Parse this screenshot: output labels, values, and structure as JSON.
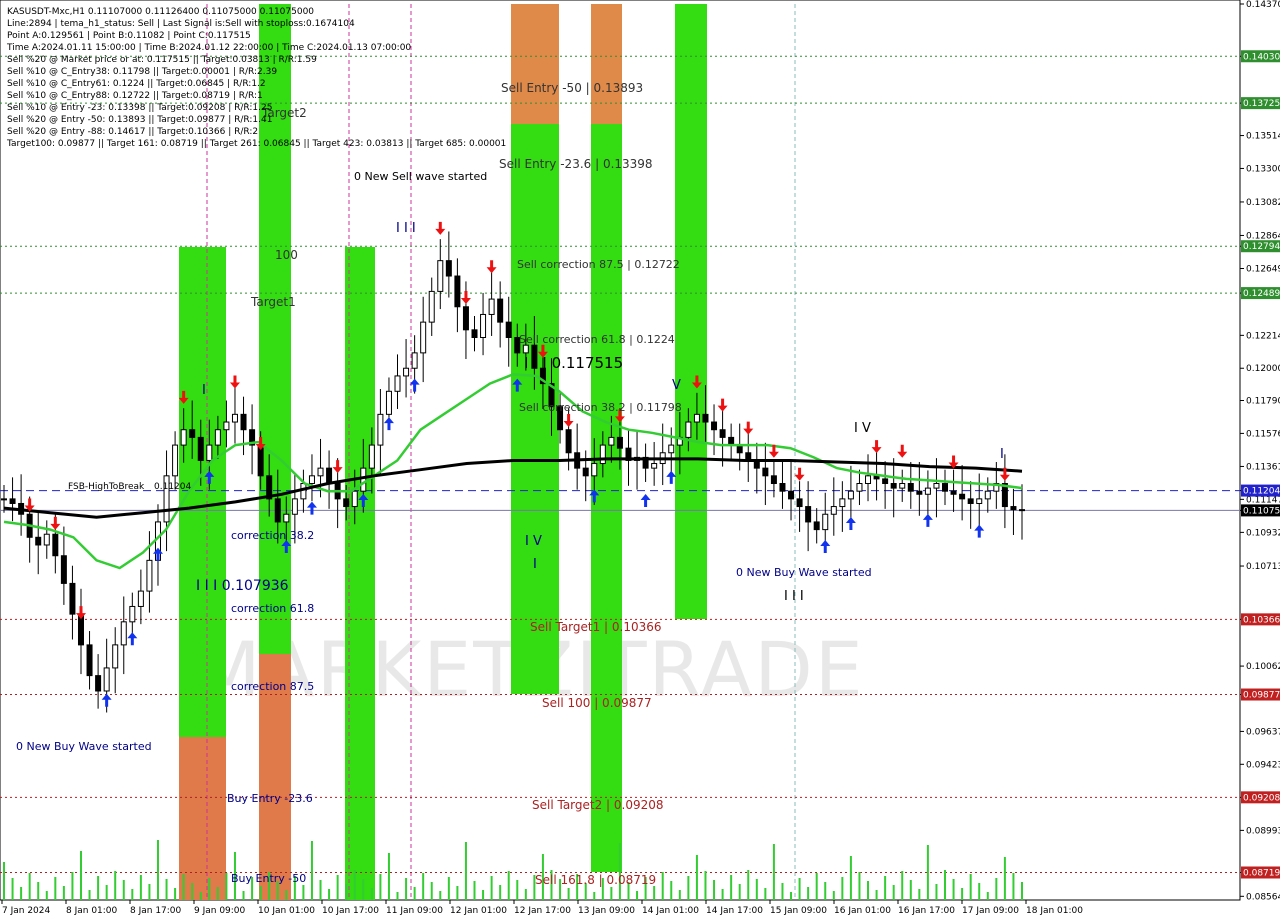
{
  "symbol_line": "KASUSDT-Mxc,H1  0.11107000 0.11126400 0.11075000 0.11075000",
  "info_lines": [
    "Line:2894 | tema_h1_status: Sell | Last Signal is:Sell with stoploss:0.1674104",
    "Point A:0.129561 | Point B:0.11082 | Point C:0.117515",
    "Time A:2024.01.11 15:00:00 | Time B:2024.01.12 22:00:00 | Time C:2024.01.13 07:00:00",
    "Sell %20 @ Market price or at: 0.117515 || Target:0.03813 | R/R:1.59",
    "Sell %10 @ C_Entry38: 0.11798 || Target:0.00001 | R/R:2.39",
    "Sell %10 @ C_Entry61: 0.1224 || Target:0.06845 | R/R:1.2",
    "Sell %10 @ C_Entry88: 0.12722 || Target:0.08719 | R/R:1",
    "Sell %10 @ Entry -23: 0.13398 || Target:0.09208 | R/R:1.25",
    "Sell %20 @ Entry -50: 0.13893 || Target:0.09877 | R/R:1.41",
    "Sell %20 @ Entry -88: 0.14617 || Target:0.10366 | R/R:2",
    "Target100: 0.09877 || Target 161: 0.08719 || Target 261: 0.06845 || Target 423: 0.03813 || Target 685: 0.00001"
  ],
  "watermark": {
    "text": "MARKETZITRADE"
  },
  "colors": {
    "green_zone": "#33dd11",
    "orange_zone": "#e07a4a",
    "buy_arrow": "#1133ee",
    "sell_arrow": "#ee1111",
    "ema_fast": "#33cc33",
    "ema_slow": "#000000",
    "candle": "#000000",
    "hline_green": "#2f8f2f",
    "hline_red": "#b02020",
    "hline_blue": "#2222cc",
    "badge_green": "#2f8f2f",
    "badge_red": "#c02020",
    "badge_blue": "#2222cc",
    "badge_black": "#000000"
  },
  "chart_data": {
    "type": "candlestick",
    "title": "KASUSDT-Mxc,H1",
    "ylim": [
      0.0854,
      0.1437
    ],
    "x_time_labels": [
      "7 Jan 2024",
      "8 Jan 01:00",
      "8 Jan 17:00",
      "9 Jan 09:00",
      "10 Jan 01:00",
      "10 Jan 17:00",
      "11 Jan 09:00",
      "12 Jan 01:00",
      "12 Jan 17:00",
      "13 Jan 09:00",
      "14 Jan 01:00",
      "14 Jan 17:00",
      "15 Jan 09:00",
      "16 Jan 01:00",
      "16 Jan 17:00",
      "17 Jan 09:00",
      "18 Jan 01:00"
    ],
    "y_tick_labels": [
      "0.14370",
      "0.14030",
      "0.13725",
      "0.13514",
      "0.13300",
      "0.13082",
      "0.12864",
      "0.12794",
      "0.12649",
      "0.12489",
      "0.12214",
      "0.12000",
      "0.11790",
      "0.11576",
      "0.11361",
      "0.11204",
      "0.11147",
      "0.11075",
      "0.10932",
      "0.10713",
      "0.10366",
      "0.10062",
      "0.09877",
      "0.09637",
      "0.09423",
      "0.09208",
      "0.08993",
      "0.08719",
      "0.08564"
    ],
    "last_price": 0.11075,
    "levels": [
      {
        "value": 0.1403,
        "label": "0.14030",
        "kind": "green"
      },
      {
        "value": 0.13725,
        "label": "0.13725",
        "kind": "green"
      },
      {
        "value": 0.12794,
        "label": "0.12794",
        "kind": "green"
      },
      {
        "value": 0.12489,
        "label": "0.12489",
        "kind": "green"
      },
      {
        "value": 0.11204,
        "label": "0.11204",
        "kind": "blue"
      },
      {
        "value": 0.10366,
        "label": "0.10366",
        "kind": "red"
      },
      {
        "value": 0.09877,
        "label": "0.09877",
        "kind": "red"
      },
      {
        "value": 0.09208,
        "label": "0.09208",
        "kind": "red"
      },
      {
        "value": 0.08719,
        "label": "0.08719",
        "kind": "red"
      }
    ],
    "annotations": [
      {
        "text": "Sell Entry -50 | 0.13893",
        "color": "#333333"
      },
      {
        "text": "Sell Entry -23.6 | 0.13398",
        "color": "#333333"
      },
      {
        "text": "Sell correction 87.5 | 0.12722",
        "color": "#333333"
      },
      {
        "text": "Sell correction 61.8 | 0.1224",
        "color": "#333333"
      },
      {
        "text": "I I I 0.117515",
        "color": "#000000"
      },
      {
        "text": "Sell correction 38.2 | 0.11798",
        "color": "#333333"
      },
      {
        "text": "Sell Target1 | 0.10366",
        "color": "#aa2222"
      },
      {
        "text": "Sell 100 | 0.09877",
        "color": "#aa2222"
      },
      {
        "text": "Sell Target2 | 0.09208",
        "color": "#aa2222"
      },
      {
        "text": "Sell 161.8 | 0.08719",
        "color": "#aa2222"
      },
      {
        "text": "0 New Sell wave started",
        "color": "#000000"
      },
      {
        "text": "0 New Buy Wave started",
        "color": "#000088"
      },
      {
        "text": "0 New Buy Wave started",
        "color": "#000088"
      },
      {
        "text": "correction 38.2",
        "color": "#000088"
      },
      {
        "text": "I I I 0.107936",
        "color": "#000088"
      },
      {
        "text": "correction 61.8",
        "color": "#000088"
      },
      {
        "text": "correction 87.5",
        "color": "#000088"
      },
      {
        "text": "Buy Entry -23.6",
        "color": "#000088"
      },
      {
        "text": "Buy Entry -50",
        "color": "#000088"
      },
      {
        "text": "Target2",
        "color": "#333333"
      },
      {
        "text": "100",
        "color": "#333333"
      },
      {
        "text": "Target1",
        "color": "#333333"
      },
      {
        "text": "FSB-HighToBreak",
        "color": "#000000"
      },
      {
        "text": "0.11204",
        "color": "#000000"
      },
      {
        "text": "I I I",
        "color": "#000088"
      },
      {
        "text": "I",
        "color": "#000088"
      },
      {
        "text": "I V",
        "color": "#000088"
      },
      {
        "text": "I",
        "color": "#000088"
      },
      {
        "text": "V",
        "color": "#000088"
      },
      {
        "text": "I V",
        "color": "#000000"
      },
      {
        "text": "I",
        "color": "#000088"
      },
      {
        "text": "I I I",
        "color": "#000000"
      }
    ],
    "series": [
      {
        "name": "Close",
        "values": [
          0.1115,
          0.1112,
          0.1105,
          0.109,
          0.1085,
          0.1092,
          0.1078,
          0.106,
          0.104,
          0.102,
          0.1,
          0.099,
          0.1005,
          0.102,
          0.1035,
          0.1045,
          0.1055,
          0.1075,
          0.11,
          0.113,
          0.115,
          0.116,
          0.1155,
          0.114,
          0.115,
          0.116,
          0.1165,
          0.117,
          0.116,
          0.115,
          0.113,
          0.1115,
          0.11,
          0.1105,
          0.1115,
          0.1125,
          0.113,
          0.1135,
          0.1125,
          0.1115,
          0.111,
          0.112,
          0.1135,
          0.115,
          0.117,
          0.1185,
          0.1195,
          0.12,
          0.121,
          0.123,
          0.125,
          0.127,
          0.126,
          0.124,
          0.1225,
          0.122,
          0.1235,
          0.1245,
          0.123,
          0.122,
          0.121,
          0.1215,
          0.12,
          0.119,
          0.1175,
          0.116,
          0.1145,
          0.1135,
          0.113,
          0.1138,
          0.115,
          0.1155,
          0.1148,
          0.114,
          0.1142,
          0.1135,
          0.1138,
          0.1145,
          0.115,
          0.1155,
          0.1165,
          0.117,
          0.1165,
          0.116,
          0.1155,
          0.115,
          0.1145,
          0.114,
          0.1135,
          0.113,
          0.1125,
          0.112,
          0.1115,
          0.111,
          0.11,
          0.1095,
          0.1105,
          0.111,
          0.1115,
          0.112,
          0.1125,
          0.113,
          0.1128,
          0.1125,
          0.1122,
          0.1125,
          0.112,
          0.1118,
          0.1122,
          0.1125,
          0.112,
          0.1118,
          0.1115,
          0.1112,
          0.1115,
          0.112,
          0.1125,
          0.111,
          0.1108,
          0.11075
        ]
      },
      {
        "name": "EMA fast",
        "values": [
          0.11,
          0.1098,
          0.1095,
          0.109,
          0.1075,
          0.107,
          0.108,
          0.1095,
          0.112,
          0.114,
          0.115,
          0.1152,
          0.114,
          0.1125,
          0.112,
          0.112,
          0.113,
          0.114,
          0.116,
          0.117,
          0.118,
          0.119,
          0.1196,
          0.1195,
          0.1185,
          0.1172,
          0.1165,
          0.116,
          0.1158,
          0.1155,
          0.1152,
          0.115,
          0.115,
          0.115,
          0.1148,
          0.1142,
          0.1135,
          0.1132,
          0.113,
          0.1128,
          0.1127,
          0.1126,
          0.1125,
          0.1124,
          0.1122
        ]
      },
      {
        "name": "EMA slow",
        "values": [
          0.1109,
          0.1106,
          0.1103,
          0.1106,
          0.1109,
          0.1113,
          0.1118,
          0.1125,
          0.113,
          0.1134,
          0.1138,
          0.114,
          0.114,
          0.1141,
          0.1141,
          0.1141,
          0.114,
          0.114,
          0.1139,
          0.1138,
          0.1136,
          0.1135,
          0.1133
        ]
      }
    ]
  }
}
